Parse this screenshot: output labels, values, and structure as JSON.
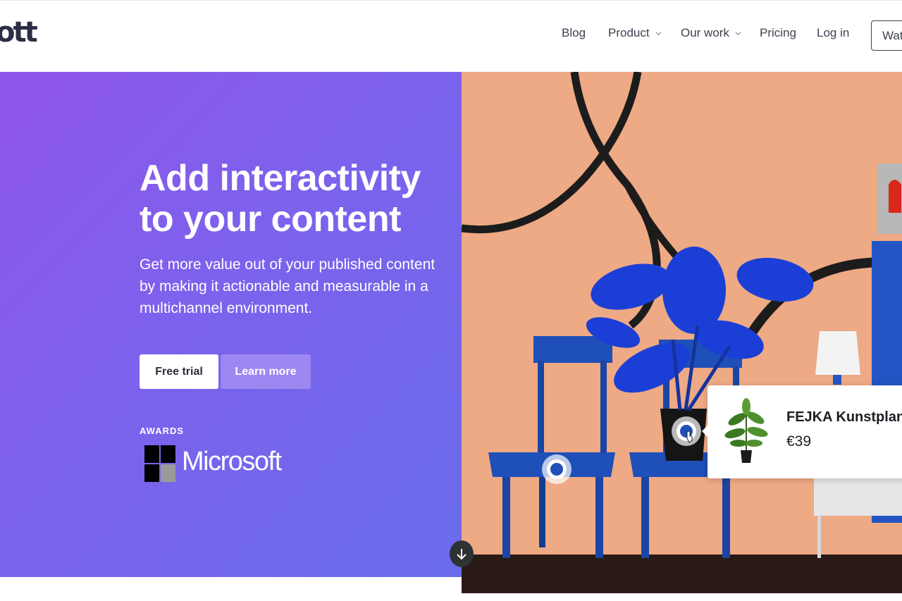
{
  "header": {
    "logo_text": "ott",
    "nav": [
      {
        "label": "Blog",
        "has_dropdown": false
      },
      {
        "label": "Product",
        "has_dropdown": true
      },
      {
        "label": "Our work",
        "has_dropdown": true
      },
      {
        "label": "Pricing",
        "has_dropdown": false
      },
      {
        "label": "Log in",
        "has_dropdown": false
      }
    ],
    "watch_label": "Watch"
  },
  "hero": {
    "title_line1": "Add interactivity",
    "title_line2": "to your content",
    "subtitle": "Get more value out of your published content by making it actionable and measurable in a multichannel environment.",
    "primary_cta": "Free trial",
    "secondary_cta": "Learn more",
    "awards_label": "AWARDS",
    "award_brand": "Microsoft"
  },
  "product_card": {
    "name": "FEJKA Kunstplant",
    "price": "€39"
  },
  "icons": {
    "scroll": "arrow-down-icon",
    "hotspot": "hotspot-icon",
    "dropdown": "chevron-down-icon"
  },
  "colors": {
    "hero_gradient_start": "#8f55ea",
    "hero_gradient_end": "#6a6cec",
    "learn_more_bg": "#9d87f0",
    "wall": "#eea985",
    "furniture_blue": "#1f4fb8"
  }
}
